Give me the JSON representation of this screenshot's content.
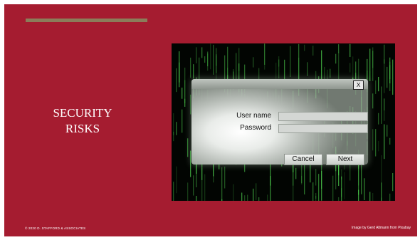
{
  "slide": {
    "title_line1": "SECURITY",
    "title_line2": "RISKS",
    "footer_left": "© 2020 D. STAFFORD & ASSOCIATES",
    "footer_right": "Image by Gerd Altmann from Pixabay"
  },
  "dialog": {
    "close_label": "X",
    "username_label": "User name",
    "password_label": "Password",
    "username_value": "",
    "password_value": "",
    "cancel_label": "Cancel",
    "next_label": "Next"
  },
  "colors": {
    "background": "#a51c30",
    "accent": "#8b7d5a",
    "matrix_green": "#4fd44f"
  }
}
